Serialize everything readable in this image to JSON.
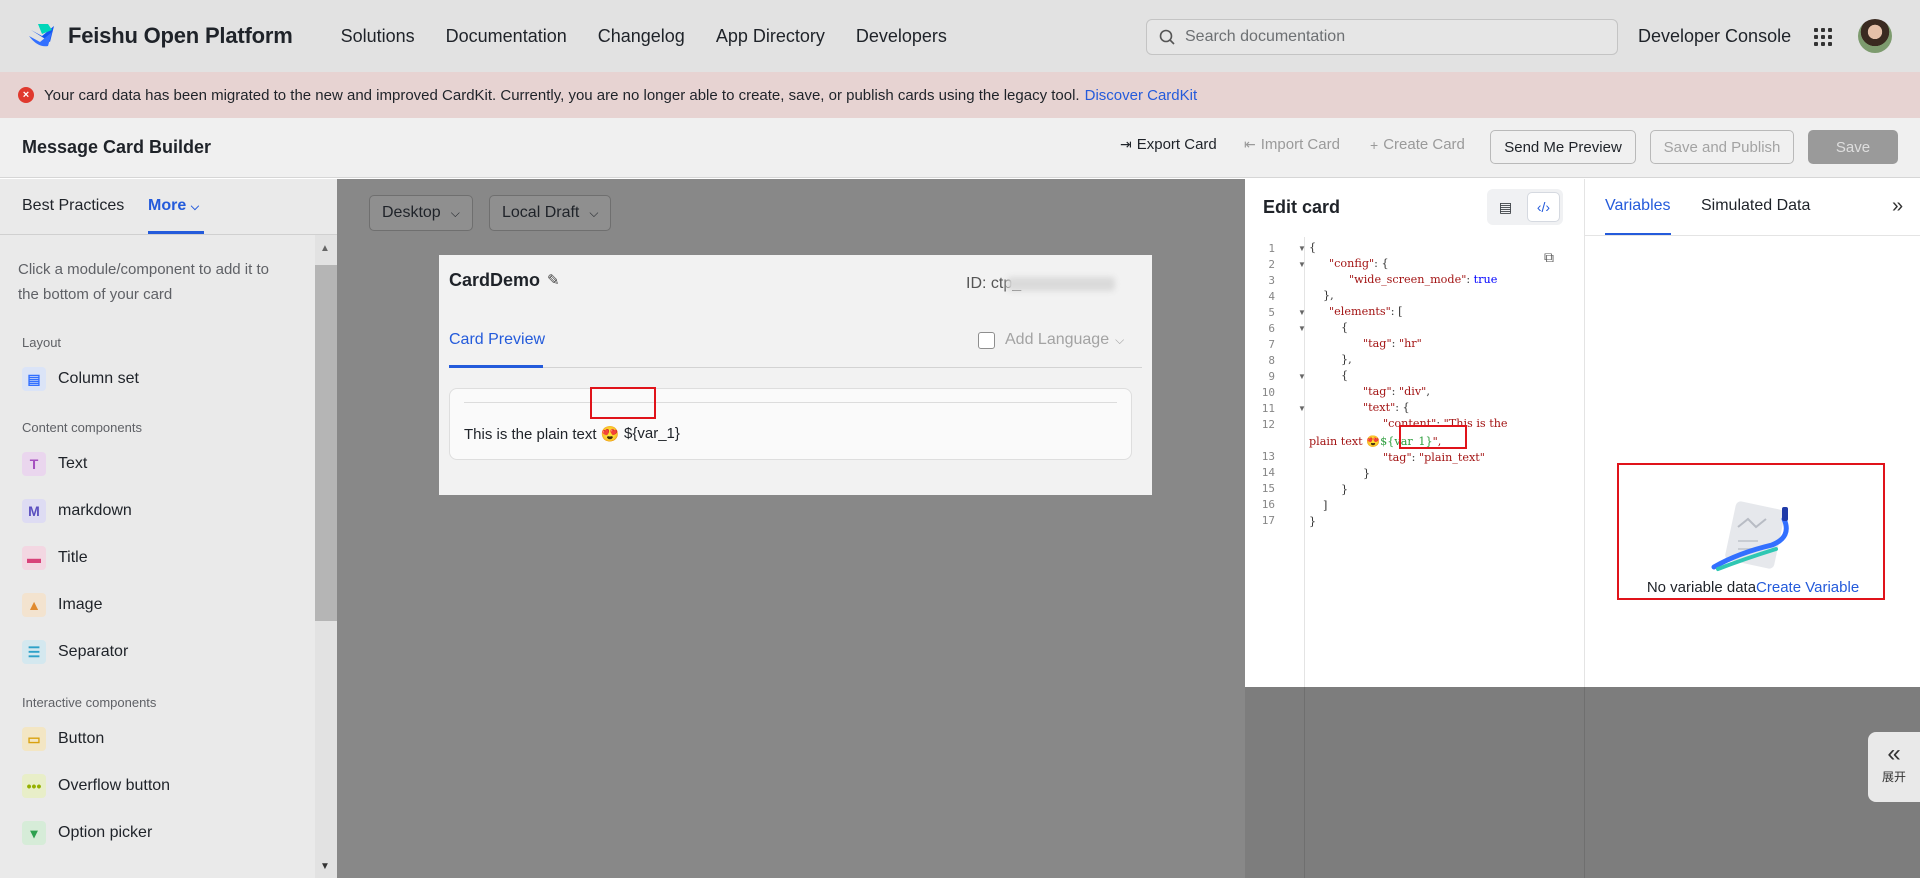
{
  "nav": {
    "brand": "Feishu Open Platform",
    "links": [
      "Solutions",
      "Documentation",
      "Changelog",
      "App Directory",
      "Developers"
    ],
    "search_placeholder": "Search documentation",
    "developer_console": "Developer Console",
    "icons": {
      "search": "search-icon",
      "apps": "grid-icon",
      "avatar": "avatar"
    }
  },
  "banner": {
    "message": "Your card data has been migrated to the new and improved CardKit. Currently, you are no longer able to create, save, or publish cards using the legacy tool.",
    "link": "Discover CardKit",
    "icon": "error-icon"
  },
  "header": {
    "title": "Message Card Builder",
    "export": "Export Card",
    "import": "Import Card",
    "create": "Create Card",
    "send_preview": "Send Me Preview",
    "save_publish": "Save and Publish",
    "save": "Save"
  },
  "left": {
    "tabs": [
      "Best Practices",
      "More"
    ],
    "hint": "Click a module/component to add it to the bottom of your card",
    "sections": {
      "layout": "Layout",
      "content": "Content components",
      "interactive": "Interactive components"
    },
    "components": {
      "column_set": "Column set",
      "text": "Text",
      "markdown": "markdown",
      "title": "Title",
      "image": "Image",
      "separator": "Separator",
      "button": "Button",
      "overflow": "Overflow button",
      "option_picker": "Option picker"
    }
  },
  "canvas": {
    "device": "Desktop",
    "draft": "Local Draft",
    "card": {
      "name": "CardDemo",
      "id_label": "ID: ctp_",
      "preview_tab": "Card Preview",
      "add_language": "Add Language",
      "plain_text": "This is the plain text 😍",
      "var": "${var_1}"
    }
  },
  "editor": {
    "title": "Edit card",
    "line_numbers": [
      "1",
      "2",
      "3",
      "4",
      "5",
      "6",
      "7",
      "8",
      "9",
      "10",
      "11",
      "12",
      "",
      "13",
      "14",
      "15",
      "16",
      "17"
    ],
    "code": {
      "l1": "{",
      "l2k": "\"config\"",
      "l2": ": {",
      "l3k": "\"wide_screen_mode\"",
      "l3v": "true",
      "l4": "},",
      "l5k": "\"elements\"",
      "l5": ": [",
      "l6": "{",
      "l7k": "\"tag\"",
      "l7v": "\"hr\"",
      "l8": "},",
      "l9": "{",
      "l10k": "\"tag\"",
      "l10v": "\"div\"",
      "l11k": "\"text\"",
      "l11": ": {",
      "l12k": "\"content\"",
      "l12v": "\"This is the",
      "l12b": "plain text 😍",
      "l12var": "${var_1}",
      "l12end": "\",",
      "l13k": "\"tag\"",
      "l13v": "\"plain_text\"",
      "l14": "}",
      "l15": "}",
      "l16": "]",
      "l17": "}"
    }
  },
  "right": {
    "tabs": [
      "Variables",
      "Simulated Data"
    ],
    "empty_text": "No variable data",
    "create_variable": "Create Variable",
    "expand_label": "展开"
  },
  "colors": {
    "accent": "#245bdb",
    "error": "#e0392e",
    "highlight_box": "#e0131a"
  }
}
